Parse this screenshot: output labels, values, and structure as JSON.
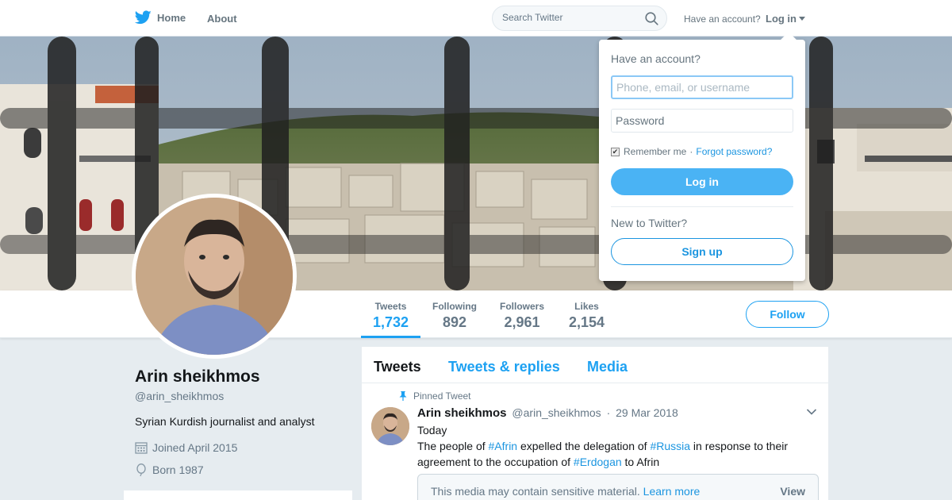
{
  "nav": {
    "home_label": "Home",
    "about_label": "About",
    "search_placeholder": "Search Twitter",
    "have_account": "Have an account?",
    "login_label": "Log in"
  },
  "profile": {
    "name": "Arin sheikhmos",
    "handle": "@arin_sheikhmos",
    "bio": "Syrian Kurdish journalist and analyst",
    "joined": "Joined April 2015",
    "born": "Born 1987",
    "follow_label": "Follow",
    "stats": [
      {
        "label": "Tweets",
        "value": "1,732"
      },
      {
        "label": "Following",
        "value": "892"
      },
      {
        "label": "Followers",
        "value": "2,961"
      },
      {
        "label": "Likes",
        "value": "2,154"
      }
    ]
  },
  "timeline": {
    "tabs": [
      "Tweets",
      "Tweets & replies",
      "Media"
    ],
    "pinned_label": "Pinned Tweet",
    "tweet": {
      "name": "Arin sheikhmos",
      "handle": "@arin_sheikhmos",
      "sep": "·",
      "date": "29 Mar 2018",
      "line1": "Today",
      "t1": "The people of ",
      "tag1": "#Afrin",
      "t2": " expelled the delegation of ",
      "tag2": "#Russia",
      "t3": " in response to their agreement to the occupation of ",
      "tag3": "#Erdogan",
      "t4": " to Afrin",
      "sensitive_msg": "This media may contain sensitive material.",
      "learn_more": "Learn more",
      "view_label": "View"
    }
  },
  "login_dropdown": {
    "title": "Have an account?",
    "username_placeholder": "Phone, email, or username",
    "password_placeholder": "Password",
    "remember_label": "Remember me",
    "sep": "·",
    "forgot_label": "Forgot password?",
    "login_button": "Log in",
    "new_label": "New to Twitter?",
    "signup_button": "Sign up"
  },
  "colors": {
    "accent": "#1da1f2",
    "link": "#1b95e0",
    "login_button": "#4ab3f4",
    "background": "#e6ecf0"
  }
}
